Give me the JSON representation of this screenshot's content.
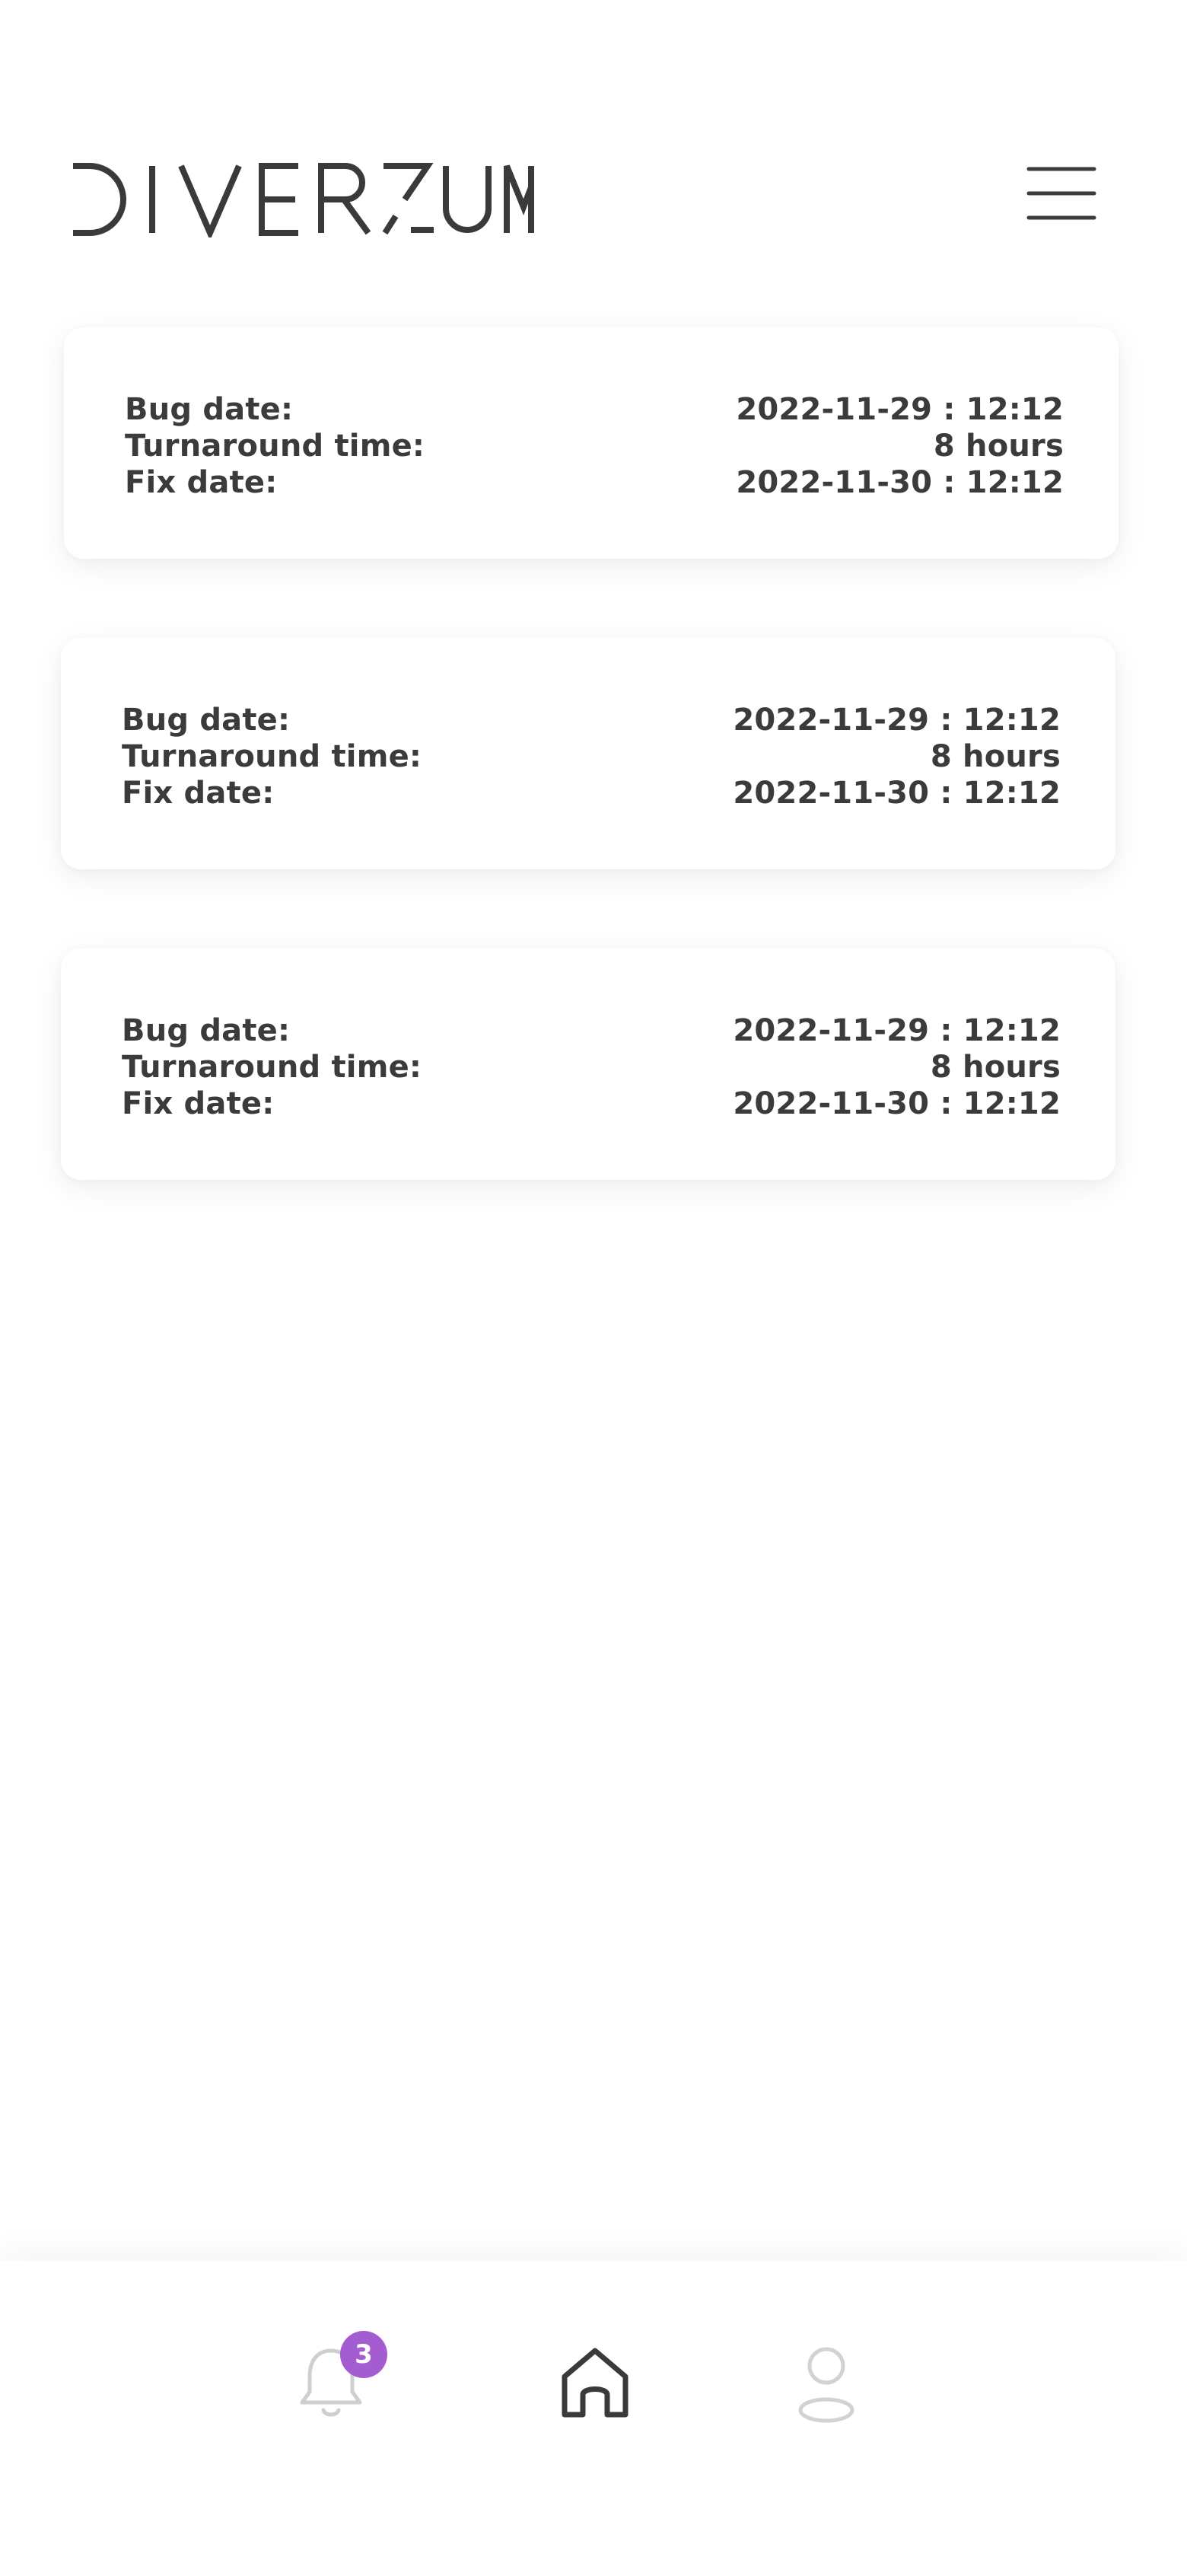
{
  "app": {
    "logo_text": "DIVERZUM"
  },
  "cards": [
    {
      "bug_date_label": "Bug date:",
      "bug_date_value": "2022-11-29 : 12:12",
      "turnaround_label": "Turnaround time:",
      "turnaround_value": "8 hours",
      "fix_date_label": "Fix date:",
      "fix_date_value": "2022-11-30 : 12:12"
    },
    {
      "bug_date_label": "Bug date:",
      "bug_date_value": "2022-11-29 : 12:12",
      "turnaround_label": "Turnaround time:",
      "turnaround_value": "8 hours",
      "fix_date_label": "Fix date:",
      "fix_date_value": "2022-11-30 : 12:12"
    },
    {
      "bug_date_label": "Bug date:",
      "bug_date_value": "2022-11-29 : 12:12",
      "turnaround_label": "Turnaround time:",
      "turnaround_value": "8 hours",
      "fix_date_label": "Fix date:",
      "fix_date_value": "2022-11-30 : 12:12"
    }
  ],
  "bottom_nav": {
    "notifications_badge": "3",
    "items": [
      {
        "icon": "bell-icon",
        "active": false
      },
      {
        "icon": "home-icon",
        "active": true
      },
      {
        "icon": "user-icon",
        "active": false
      }
    ]
  },
  "colors": {
    "text": "#3b3b3b",
    "badge": "#a35dd0",
    "inactive_icon": "#cfcfcf",
    "active_icon": "#3a3a3a"
  }
}
